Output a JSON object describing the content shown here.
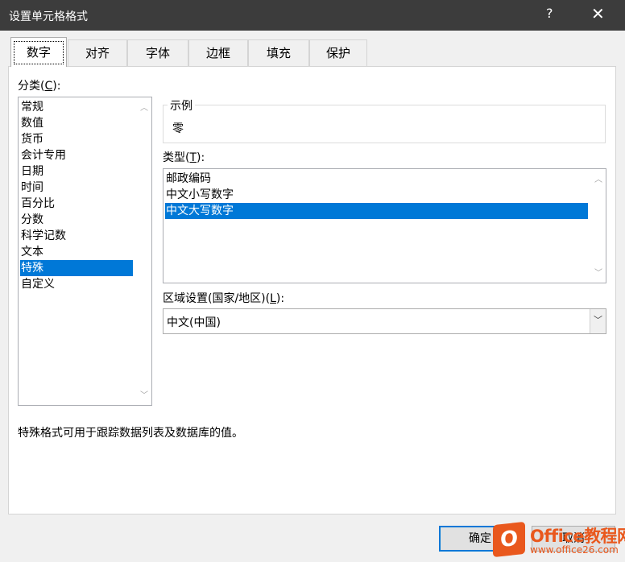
{
  "window": {
    "title": "设置单元格格式",
    "help_label": "?",
    "close_label": "✕"
  },
  "tabs": [
    {
      "label": "数字",
      "active": true
    },
    {
      "label": "对齐"
    },
    {
      "label": "字体"
    },
    {
      "label": "边框"
    },
    {
      "label": "填充"
    },
    {
      "label": "保护"
    }
  ],
  "category": {
    "label": "分类",
    "accesskey": "C",
    "items": [
      "常规",
      "数值",
      "货币",
      "会计专用",
      "日期",
      "时间",
      "百分比",
      "分数",
      "科学记数",
      "文本",
      "特殊",
      "自定义"
    ],
    "selected": "特殊"
  },
  "sample": {
    "label": "示例",
    "value": "零"
  },
  "type": {
    "label": "类型",
    "accesskey": "T",
    "items": [
      "邮政编码",
      "中文小写数字",
      "中文大写数字"
    ],
    "selected": "中文大写数字"
  },
  "locale": {
    "label": "区域设置(国家/地区)",
    "accesskey": "L",
    "value": "中文(中国)"
  },
  "description": "特殊格式可用于跟踪数据列表及数据库的值。",
  "buttons": {
    "ok": "确定",
    "cancel": "取消"
  },
  "watermark": {
    "logo_letter": "O",
    "brand": "Office教程网",
    "url": "www.office26.com"
  },
  "colors": {
    "titlebar": "#3c3c3c",
    "selection": "#0078d7",
    "watermark": "#e9581d"
  }
}
